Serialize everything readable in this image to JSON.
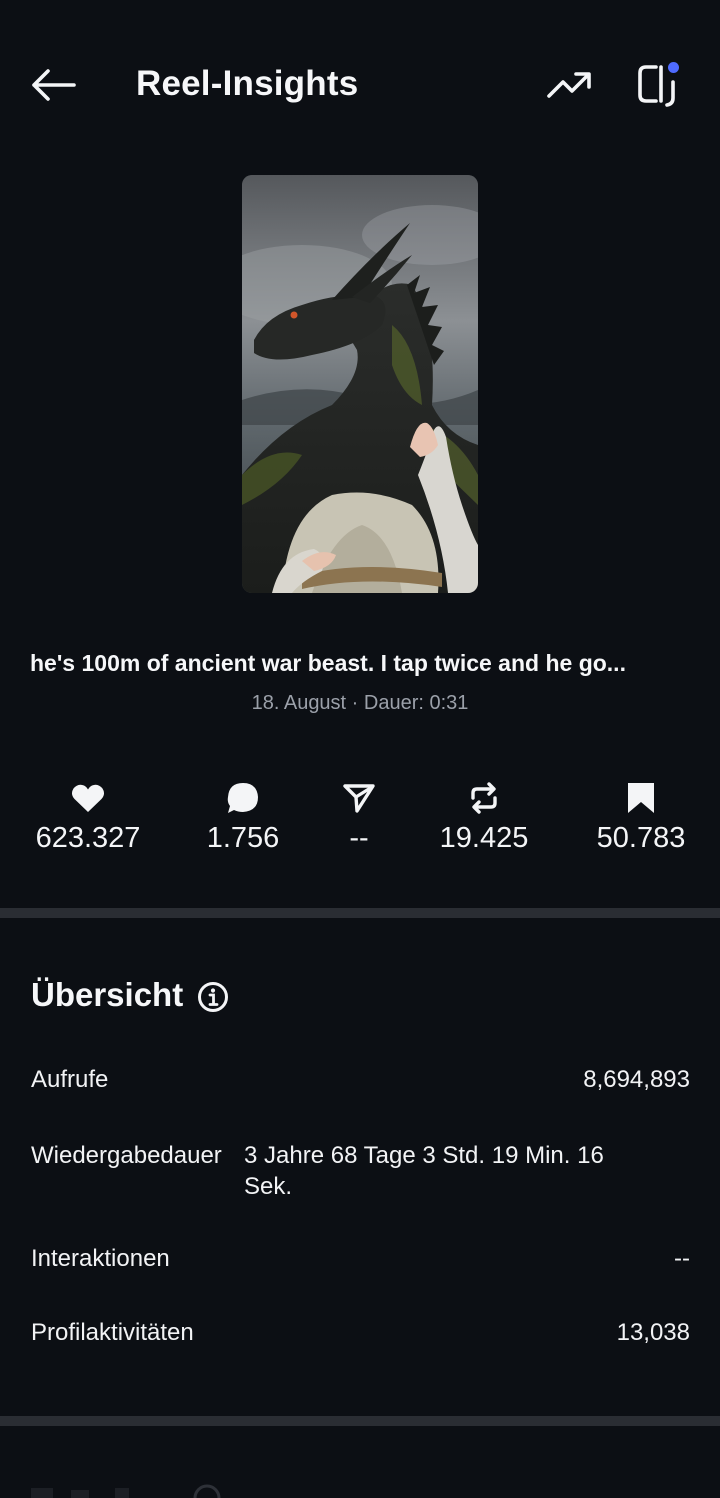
{
  "header": {
    "title": "Reel-Insights",
    "back_icon": "arrow-left-icon",
    "trend_icon": "trending-up-icon",
    "threads_icon": "threads-icon",
    "badge_color": "#4f6bff"
  },
  "reel": {
    "thumbnail": "dragon-reel-thumbnail",
    "caption": "he's 100m of ancient war beast. I tap twice and he go...",
    "meta": "18. August · Dauer: 0:31"
  },
  "stats": [
    {
      "icon": "heart-icon",
      "value": "623.327"
    },
    {
      "icon": "comment-icon",
      "value": "1.756"
    },
    {
      "icon": "send-icon",
      "value": "--"
    },
    {
      "icon": "repost-icon",
      "value": "19.425"
    },
    {
      "icon": "bookmark-icon",
      "value": "50.783"
    }
  ],
  "overview": {
    "title": "Übersicht",
    "info_icon": "info-icon",
    "rows": [
      {
        "label": "Aufrufe",
        "value": "8,694,893"
      },
      {
        "label": "Wiedergabedauer",
        "value": "3 Jahre 68 Tage 3 Std. 19 Min. 16 Sek."
      },
      {
        "label": "Interaktionen",
        "value": "--"
      },
      {
        "label": "Profilaktivitäten",
        "value": "13,038"
      }
    ]
  },
  "colors": {
    "background": "#0c0f14",
    "divider": "#2a2d33",
    "text": "#f4f5f7",
    "muted": "#9ba0a9"
  }
}
